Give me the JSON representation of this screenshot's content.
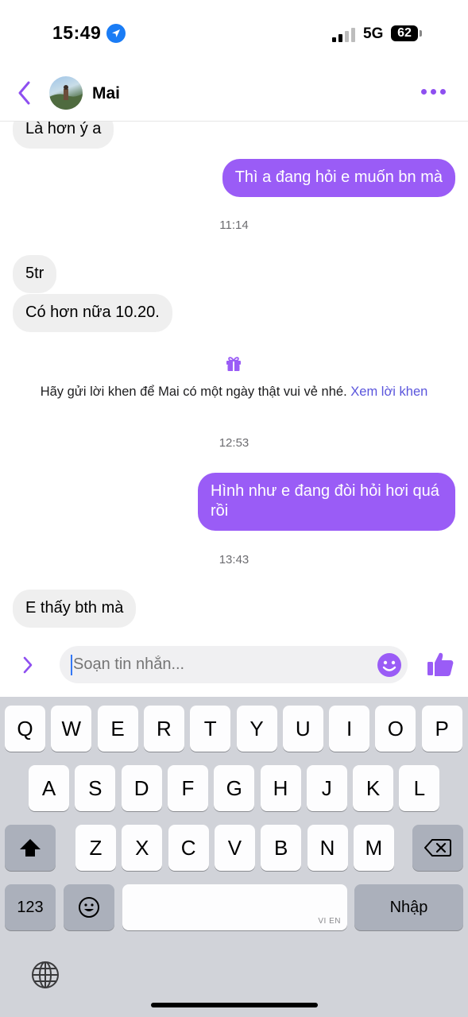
{
  "status_bar": {
    "time": "15:49",
    "network": "5G",
    "battery": "62"
  },
  "header": {
    "contact_name": "Mai",
    "back_icon": "chevron-left-icon",
    "more_icon": "more-dots-icon"
  },
  "messages": [
    {
      "side": "in",
      "text": "Là hơn ý a"
    },
    {
      "side": "out",
      "text": "Thì a đang hỏi e muốn bn mà"
    },
    {
      "timestamp": "11:14"
    },
    {
      "side": "in",
      "text": "5tr"
    },
    {
      "side": "in",
      "text": "Có hơn nữa 10.20."
    },
    {
      "notice": "Hãy gửi lời khen để Mai có một ngày thật vui vẻ nhé.",
      "link": "Xem lời khen"
    },
    {
      "timestamp": "12:53"
    },
    {
      "side": "out",
      "text": "Hình như e đang đòi hỏi hơi quá rồi"
    },
    {
      "timestamp": "13:43"
    },
    {
      "side": "in",
      "text": "E thấy bth mà"
    }
  ],
  "composer": {
    "placeholder": "Soạn tin nhắn..."
  },
  "keyboard": {
    "row1": [
      "Q",
      "W",
      "E",
      "R",
      "T",
      "Y",
      "U",
      "I",
      "O",
      "P"
    ],
    "row2": [
      "A",
      "S",
      "D",
      "F",
      "G",
      "H",
      "J",
      "K",
      "L"
    ],
    "row3": [
      "Z",
      "X",
      "C",
      "V",
      "B",
      "N",
      "M"
    ],
    "numbers_key": "123",
    "return_key": "Nhập",
    "space_hint": "VI EN"
  },
  "colors": {
    "accent": "#9a5cf6",
    "incoming_bubble": "#efefef",
    "link": "#5a55dc"
  }
}
